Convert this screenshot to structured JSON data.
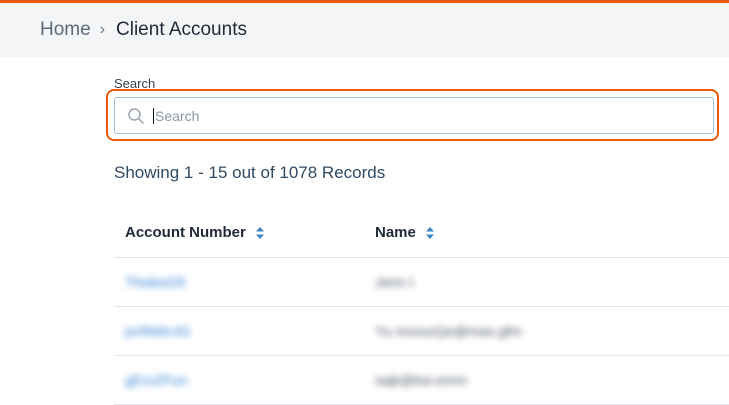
{
  "breadcrumb": {
    "home": "Home",
    "separator": "›",
    "current": "Client Accounts"
  },
  "search": {
    "label": "Search",
    "placeholder": "Search",
    "value": ""
  },
  "records_summary": "Showing 1 - 15 out of 1078 Records",
  "table": {
    "columns": [
      "Account Number",
      "Name"
    ],
    "rows": [
      {
        "account": "TNxkixD5",
        "name": "Jenn t"
      },
      {
        "account": "pcRk6nJG",
        "name": "Yu resourQe@mas.gfm"
      },
      {
        "account": "gEroZFun",
        "name": "sajk@bsi.emm"
      }
    ]
  },
  "colors": {
    "accent": "#ea580c",
    "link": "#2b7fd6",
    "sort_icon": "#3b82c4"
  }
}
